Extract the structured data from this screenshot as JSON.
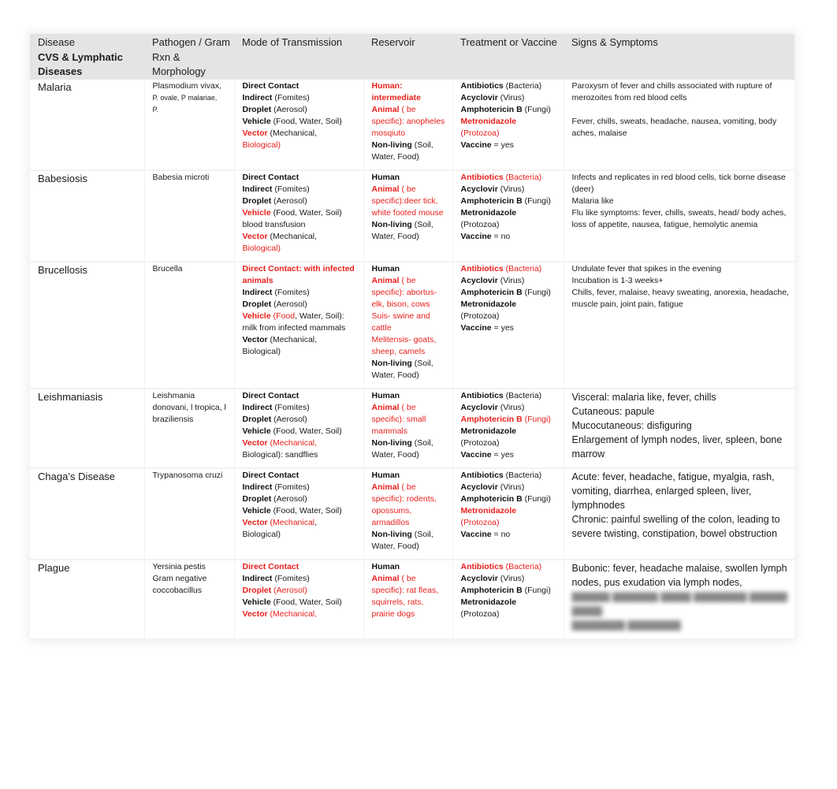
{
  "header": {
    "disease": "Disease",
    "category_line1": "CVS & Lymphatic",
    "category_line2": "Diseases",
    "pathogen": "Pathogen / Gram Rxn & Morphology",
    "transmission": "Mode of Transmission",
    "reservoir": "Reservoir",
    "treatment": "Treatment or Vaccine",
    "symptoms": "Signs & Symptoms"
  },
  "colors": {
    "highlight": "#e8201c",
    "header_bg": "#e4e4e4"
  },
  "rows": [
    {
      "disease": "Malaria",
      "pathogen": [
        "Plasmodium vivax,",
        "P. ovale, P malariae,",
        "P."
      ],
      "transmission": {
        "direct": {
          "label": "Direct Contact",
          "note": ""
        },
        "indirect": {
          "label": "Indirect",
          "note": "(Fomites)"
        },
        "droplet": {
          "label": "Droplet",
          "note": "(Aerosol)"
        },
        "vehicle": {
          "label": "Vehicle",
          "note": "(Food, Water, Soil)"
        },
        "vector": {
          "label": "Vector",
          "note1": "(Mechanical,",
          "note2": "Biological)"
        }
      },
      "reservoir": {
        "human": "Human: intermediate",
        "animal_label": "Animal",
        "animal_note": "( be specific): anopheles mosqiuto",
        "nonliving_label": "Non-living",
        "nonliving_note": "(Soil, Water, Food)"
      },
      "treatment": {
        "antibiotics": "Antibiotics",
        "antibiotics_note": "(Bacteria)",
        "acyclovir": "Acyclovir",
        "acyclovir_note": "(Virus)",
        "amphotericin": "Amphotericin B",
        "amphotericin_note": "(Fungi)",
        "metronidazole": "Metronidazole",
        "metronidazole_note": "(Protozoa)",
        "vaccine_label": "Vaccine",
        "vaccine_value": "= yes"
      },
      "symptoms": [
        "Paroxysm of fever and chills associated with rupture of merozoites from red blood cells",
        "Fever, chills, sweats, headache, nausea, vomiting, body aches, malaise"
      ]
    },
    {
      "disease": "Babesiosis",
      "pathogen": [
        "Babesia microti"
      ],
      "transmission": {
        "direct": {
          "label": "Direct Contact"
        },
        "indirect": {
          "label": "Indirect",
          "note": "(Fomites)"
        },
        "droplet": {
          "label": "Droplet",
          "note": "(Aerosol)"
        },
        "vehicle": {
          "label": "Vehicle",
          "note": "(Food, Water, Soil)",
          "extra": "blood transfusion"
        },
        "vector": {
          "label": "Vector",
          "note1": "(Mechanical,",
          "note2": "Biological)"
        }
      },
      "reservoir": {
        "human": "Human",
        "animal_label": "Animal",
        "animal_note": "( be specific):deer tick, white footed mouse",
        "nonliving_label": "Non-living",
        "nonliving_note": "(Soil, Water, Food)"
      },
      "treatment": {
        "antibiotics": "Antibiotics",
        "antibiotics_note": "(Bacteria)",
        "acyclovir": "Acyclovir",
        "acyclovir_note": "(Virus)",
        "amphotericin": "Amphotericin B",
        "amphotericin_note": "(Fungi)",
        "metronidazole": "Metronidazole",
        "metronidazole_note": "(Protozoa)",
        "vaccine_label": "Vaccine",
        "vaccine_value": "= no"
      },
      "symptoms": [
        "Infects and replicates in red blood cells, tick borne disease (deer)",
        "Malaria like",
        "Flu like symptoms: fever, chills, sweats, head/ body aches, loss of appetite, nausea, fatigue, hemolytic anemia"
      ]
    },
    {
      "disease": "Brucellosis",
      "pathogen": [
        "Brucella"
      ],
      "transmission": {
        "direct": {
          "label": "Direct Contact: with infected animals"
        },
        "indirect": {
          "label": "Indirect",
          "note": "(Fomites)"
        },
        "droplet": {
          "label": "Droplet",
          "note": "(Aerosol)"
        },
        "vehicle": {
          "label": "Vehicle",
          "note_red": "Food",
          "note_rest": ", Water, Soil):",
          "extra": "milk from infected mammals"
        },
        "vector": {
          "label": "Vector",
          "note1": "(Mechanical,",
          "note2": "Biological)"
        }
      },
      "reservoir": {
        "human": "Human",
        "animal_label": "Animal",
        "animal_note": "( be specific): abortus- elk, bison, cows",
        "extra1": "Suis- swine and cattle",
        "extra2": "Melitensis- goats, sheep, camels",
        "nonliving_label": "Non-living",
        "nonliving_note": "(Soil, Water, Food)"
      },
      "treatment": {
        "antibiotics": "Antibiotics",
        "antibiotics_note": "(Bacteria)",
        "acyclovir": "Acyclovir",
        "acyclovir_note": "(Virus)",
        "amphotericin": "Amphotericin B",
        "amphotericin_note": "(Fungi)",
        "metronidazole": "Metronidazole",
        "metronidazole_note": "(Protozoa)",
        "vaccine_label": "Vaccine",
        "vaccine_value": "= yes"
      },
      "symptoms": [
        "Undulate fever that spikes in the evening",
        "Incubation is 1-3 weeks+",
        "Chills, fever, malaise, heavy sweating, anorexia, headache, muscle pain, joint pain, fatigue"
      ]
    },
    {
      "disease": "Leishmaniasis",
      "pathogen": [
        "Leishmania donovani, l tropica, l braziliensis"
      ],
      "transmission": {
        "direct": {
          "label": "Direct Contact"
        },
        "indirect": {
          "label": "Indirect",
          "note": "(Fomites)"
        },
        "droplet": {
          "label": "Droplet",
          "note": "(Aerosol)"
        },
        "vehicle": {
          "label": "Vehicle",
          "note": "(Food, Water, Soil)"
        },
        "vector": {
          "label": "Vector",
          "note1": "(Mechanical,",
          "note2": "Biological): sandflies"
        }
      },
      "reservoir": {
        "human": "Human",
        "animal_label": "Animal",
        "animal_note": "( be specific): small mammals",
        "nonliving_label": "Non-living",
        "nonliving_note": "(Soil, Water, Food)"
      },
      "treatment": {
        "antibiotics": "Antibiotics",
        "antibiotics_note": "(Bacteria)",
        "acyclovir": "Acyclovir",
        "acyclovir_note": "(Virus)",
        "amphotericin": "Amphotericin B",
        "amphotericin_note": "(Fungi)",
        "metronidazole": "Metronidazole",
        "metronidazole_note": "(Protozoa)",
        "vaccine_label": "Vaccine",
        "vaccine_value": "= yes"
      },
      "symptoms": [
        "Visceral: malaria like, fever, chills",
        "Cutaneous: papule",
        "Mucocutaneous: disfiguring",
        "Enlargement of lymph nodes, liver, spleen, bone marrow"
      ]
    },
    {
      "disease": "Chaga’s Disease",
      "pathogen": [
        "Trypanosoma cruzi"
      ],
      "transmission": {
        "direct": {
          "label": "Direct Contact"
        },
        "indirect": {
          "label": "Indirect",
          "note": "(Fomites)"
        },
        "droplet": {
          "label": "Droplet",
          "note": "(Aerosol)"
        },
        "vehicle": {
          "label": "Vehicle",
          "note": "(Food, Water, Soil)"
        },
        "vector": {
          "label": "Vector",
          "note1": "(Mechanical",
          "note1_rest": ",",
          "note2": "Biological)"
        }
      },
      "reservoir": {
        "human": "Human",
        "animal_label": "Animal",
        "animal_note": "( be specific): rodents, opossums, armadillos",
        "nonliving_label": "Non-living",
        "nonliving_note": "(Soil, Water, Food)"
      },
      "treatment": {
        "antibiotics": "Antibiotics",
        "antibiotics_note": "(Bacteria)",
        "acyclovir": "Acyclovir",
        "acyclovir_note": "(Virus)",
        "amphotericin": "Amphotericin B",
        "amphotericin_note": "(Fungi)",
        "metronidazole": "Metronidazole",
        "metronidazole_note": "(Protozoa)",
        "vaccine_label": "Vaccine",
        "vaccine_value": "= no"
      },
      "symptoms": [
        "Acute: fever, headache, fatigue, myalgia, rash, vomiting, diarrhea, enlarged spleen, liver, lymphnodes",
        "Chronic: painful swelling of the colon, leading to severe twisting, constipation, bowel obstruction"
      ]
    },
    {
      "disease": "Plague",
      "pathogen": [
        "Yersinia pestis",
        "Gram negative",
        "coccobacillus"
      ],
      "transmission": {
        "direct": {
          "label": "Direct Contact"
        },
        "indirect": {
          "label": "Indirect",
          "note": "(Fomites)"
        },
        "droplet": {
          "label": "Droplet",
          "note": "(Aerosol)"
        },
        "vehicle": {
          "label": "Vehicle",
          "note": "(Food, Water, Soil)"
        },
        "vector": {
          "label": "Vector",
          "note1": "(Mechanical,"
        }
      },
      "reservoir": {
        "human": "Human",
        "animal_label": "Animal",
        "animal_note": "( be specific): rat fleas, squirrels, rats, prairie dogs"
      },
      "treatment": {
        "antibiotics": "Antibiotics",
        "antibiotics_note": "(Bacteria)",
        "acyclovir": "Acyclovir",
        "acyclovir_note": "(Virus)",
        "amphotericin": "Amphotericin B",
        "amphotericin_note": "(Fungi)",
        "metronidazole": "Metronidazole",
        "metronidazole_note": "(Protozoa)"
      },
      "symptoms": [
        "Bubonic: fever, headache malaise, swollen lymph nodes, pus exudation via lymph nodes,"
      ],
      "symptoms_obscured": "blurred text continues"
    }
  ]
}
